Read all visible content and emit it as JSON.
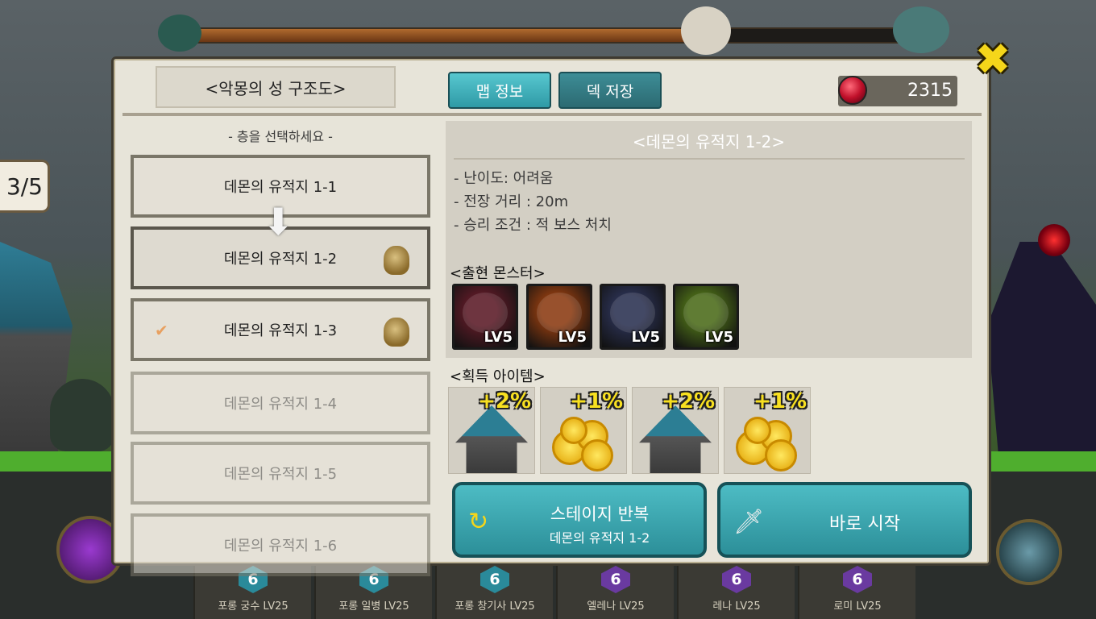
{
  "top_progress": {
    "fill_fraction": 0.72
  },
  "side_counter": "3/5",
  "panel": {
    "title": "<악몽의 성 구조도>",
    "tabs": [
      {
        "label": "맵 정보",
        "active": true
      },
      {
        "label": "덱 저장",
        "active": false
      }
    ],
    "currency": {
      "icon": "red-gem-icon",
      "value": "2315"
    },
    "floor_prompt": "- 층을 선택하세요 -",
    "floors": [
      {
        "label": "데몬의 유적지 1-1",
        "state": "unlocked",
        "skull": false,
        "check": false
      },
      {
        "label": "데몬의 유적지 1-2",
        "state": "selected",
        "skull": true,
        "check": false
      },
      {
        "label": "데몬의 유적지 1-3",
        "state": "cleared",
        "skull": true,
        "check": true
      },
      {
        "label": "데몬의 유적지 1-4",
        "state": "locked",
        "skull": false,
        "check": false
      },
      {
        "label": "데몬의 유적지 1-5",
        "state": "locked",
        "skull": false,
        "check": false
      },
      {
        "label": "데몬의 유적지 1-6",
        "state": "locked",
        "skull": false,
        "check": false
      }
    ],
    "info": {
      "title": "<데몬의 유적지 1-2>",
      "details": [
        "- 난이도: 어려움",
        "- 전장 거리 : 20m",
        "- 승리 조건 : 적 보스 처치"
      ],
      "monsters_title": "<출현 몬스터>",
      "monsters": [
        {
          "level": "LV5",
          "icon": "red-demon-icon",
          "color": "#5a1a26"
        },
        {
          "level": "LV5",
          "icon": "orange-beast-icon",
          "color": "#8a3a10"
        },
        {
          "level": "LV5",
          "icon": "chained-golem-icon",
          "color": "#2a3050"
        },
        {
          "level": "LV5",
          "icon": "green-goblin-icon",
          "color": "#4a6a18"
        }
      ],
      "items_title": "<획득 아이템>",
      "items": [
        {
          "bonus": "+2%",
          "icon": "tower-icon"
        },
        {
          "bonus": "+1%",
          "icon": "gold-coins-icon"
        },
        {
          "bonus": "+2%",
          "icon": "tower-icon"
        },
        {
          "bonus": "+1%",
          "icon": "gold-coins-icon"
        }
      ]
    },
    "buttons": {
      "repeat": {
        "label": "스테이지 반복",
        "sub": "데몬의 유적지 1-2",
        "icon": "repeat-icon"
      },
      "start": {
        "label": "바로 시작",
        "icon": "sword-icon"
      }
    }
  },
  "units": [
    {
      "cost": "6",
      "name": "포롱 궁수 LV25",
      "gem_color": "#2a8a9a"
    },
    {
      "cost": "6",
      "name": "포롱 일병 LV25",
      "gem_color": "#2a8a9a"
    },
    {
      "cost": "6",
      "name": "포롱 창기사 LV25",
      "gem_color": "#2a8a9a"
    },
    {
      "cost": "6",
      "name": "엘레나 LV25",
      "gem_color": "#6a3aa0"
    },
    {
      "cost": "6",
      "name": "레나 LV25",
      "gem_color": "#6a3aa0"
    },
    {
      "cost": "6",
      "name": "로미 LV25",
      "gem_color": "#6a3aa0"
    }
  ]
}
